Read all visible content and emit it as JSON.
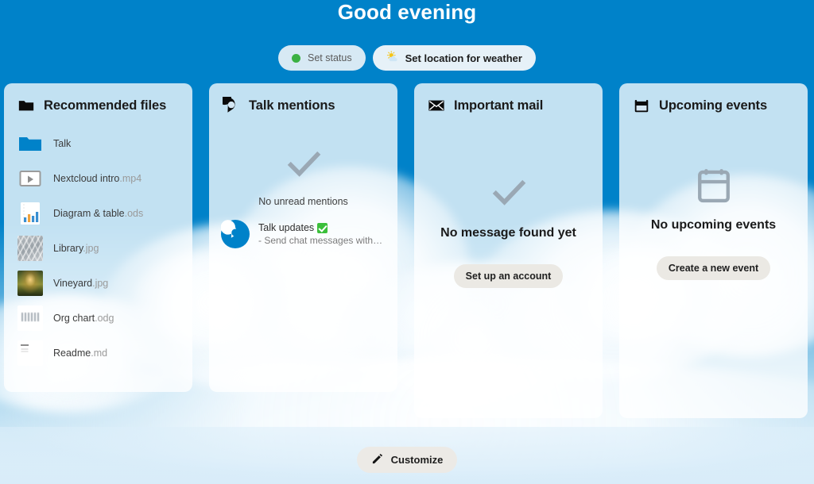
{
  "header": {
    "greeting": "Good evening",
    "status_button": {
      "label": "Set status",
      "icon": "green-dot-icon",
      "dot_color": "#3bb143"
    },
    "weather_button": {
      "label": "Set location for weather",
      "icon": "sun-cloud-icon"
    }
  },
  "theme": {
    "primary": "#0082c9",
    "card_bg": "#d5e7f3",
    "button_bg": "#ebe9e4",
    "text": "#1a1a1a",
    "muted": "#9a9a9a"
  },
  "cards": [
    {
      "id": "recommended-files",
      "title": "Recommended files",
      "icon": "folder-icon",
      "files": [
        {
          "name": "Talk",
          "ext": "",
          "icon": "folder-blue-icon"
        },
        {
          "name": "Nextcloud intro",
          "ext": ".mp4",
          "icon": "video-icon"
        },
        {
          "name": "Diagram & table",
          "ext": ".ods",
          "icon": "spreadsheet-icon"
        },
        {
          "name": "Library",
          "ext": ".jpg",
          "icon": "image-thumb-library"
        },
        {
          "name": "Vineyard",
          "ext": ".jpg",
          "icon": "image-thumb-vineyard"
        },
        {
          "name": "Org chart",
          "ext": ".odg",
          "icon": "drawing-thumb-orgchart"
        },
        {
          "name": "Readme",
          "ext": ".md",
          "icon": "text-thumb-readme"
        }
      ]
    },
    {
      "id": "talk-mentions",
      "title": "Talk mentions",
      "icon": "talk-icon",
      "empty_icon": "check-icon",
      "empty_text": "No unread mentions",
      "item": {
        "avatar": "talk-avatar-icon",
        "title": "Talk updates",
        "badge": "verified-check-badge",
        "subtitle": "- Send chat messages without ..."
      }
    },
    {
      "id": "important-mail",
      "title": "Important mail",
      "icon": "envelope-icon",
      "empty_icon": "check-icon",
      "empty_text": "No message found yet",
      "button": "Set up an account"
    },
    {
      "id": "upcoming-events",
      "title": "Upcoming events",
      "icon": "calendar-icon",
      "empty_icon": "calendar-outline-icon",
      "empty_text": "No upcoming events",
      "button": "Create a new event"
    }
  ],
  "footer": {
    "customize_label": "Customize",
    "customize_icon": "pencil-icon"
  }
}
